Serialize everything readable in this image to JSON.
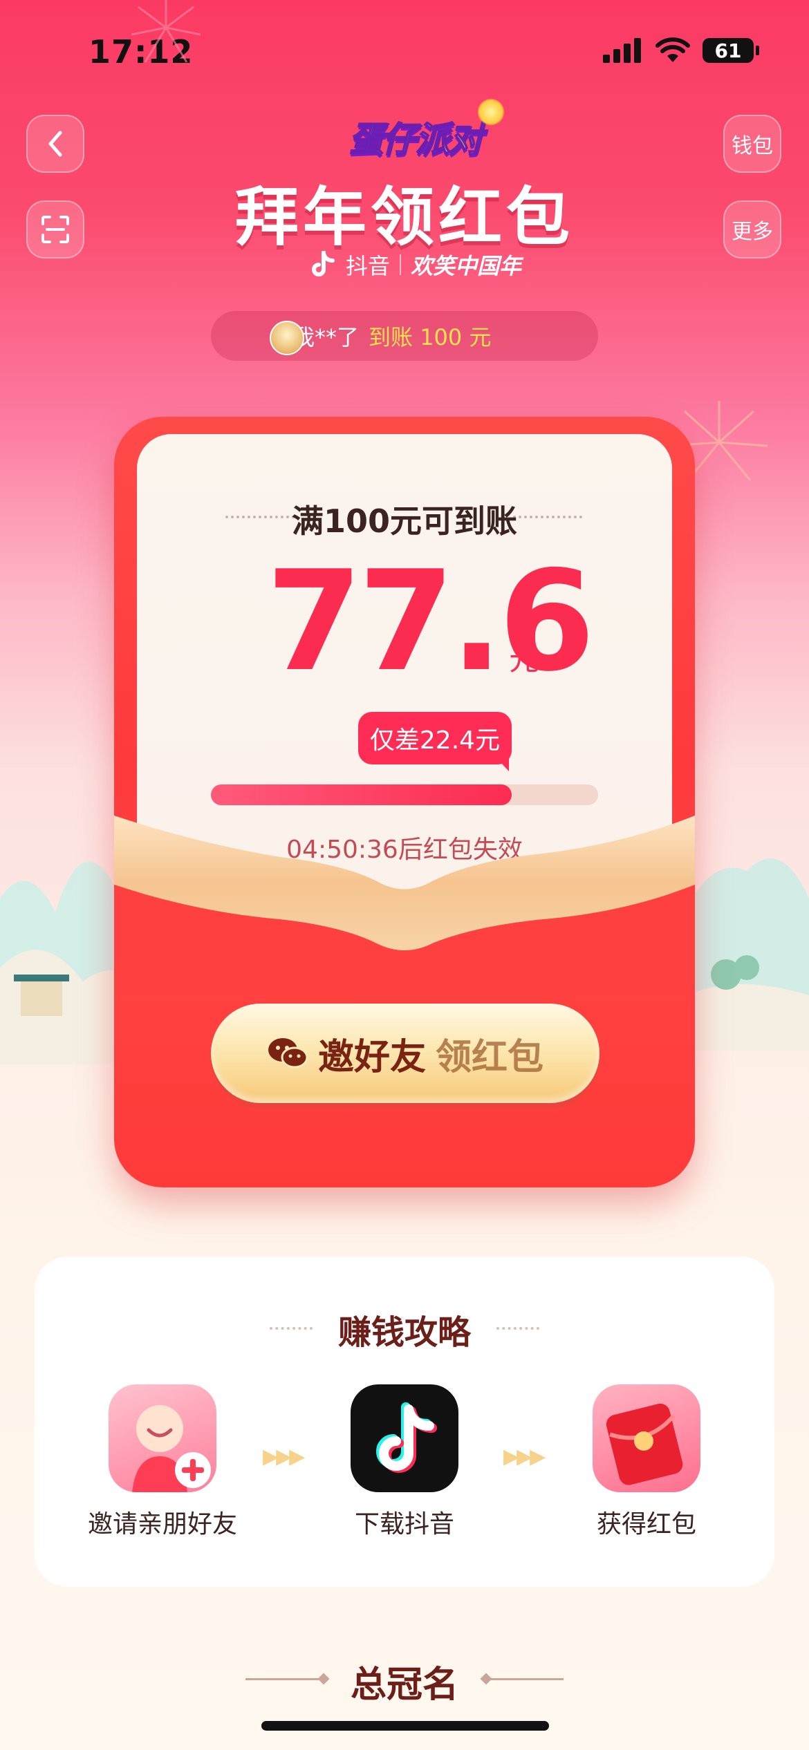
{
  "status_bar": {
    "time": "17:12",
    "battery": "61"
  },
  "nav": {
    "back_icon": "chevron-left-icon",
    "scan_icon": "scan-icon",
    "wallet_label": "钱包",
    "more_label": "更多"
  },
  "header": {
    "logo_text": "蛋仔派对",
    "title": "拜年领红包",
    "brand": "抖音",
    "slogan": "欢笑中国年"
  },
  "notice": {
    "user": "@我**了",
    "message": "到账 100 元"
  },
  "red_packet": {
    "goal_text": "满100元可到账",
    "amount": "77.6",
    "unit": "元",
    "remaining_text": "仅差22.4元",
    "progress": 0.776,
    "countdown_text": "04:50:36后红包失效",
    "invite_label": "邀好友",
    "invite_label_2": "领红包"
  },
  "strategy": {
    "title": "赚钱攻略",
    "steps": [
      {
        "label": "邀请亲朋好友",
        "icon": "invite-friend-icon"
      },
      {
        "label": "下载抖音",
        "icon": "douyin-app-icon"
      },
      {
        "label": "获得红包",
        "icon": "red-envelope-icon"
      }
    ]
  },
  "footer": {
    "title": "总冠名"
  },
  "colors": {
    "brand_red": "#fc2c51",
    "envelope_red": "#ff3a3d",
    "gold": "#ffe14d",
    "dark_brown": "#6b1f18"
  }
}
